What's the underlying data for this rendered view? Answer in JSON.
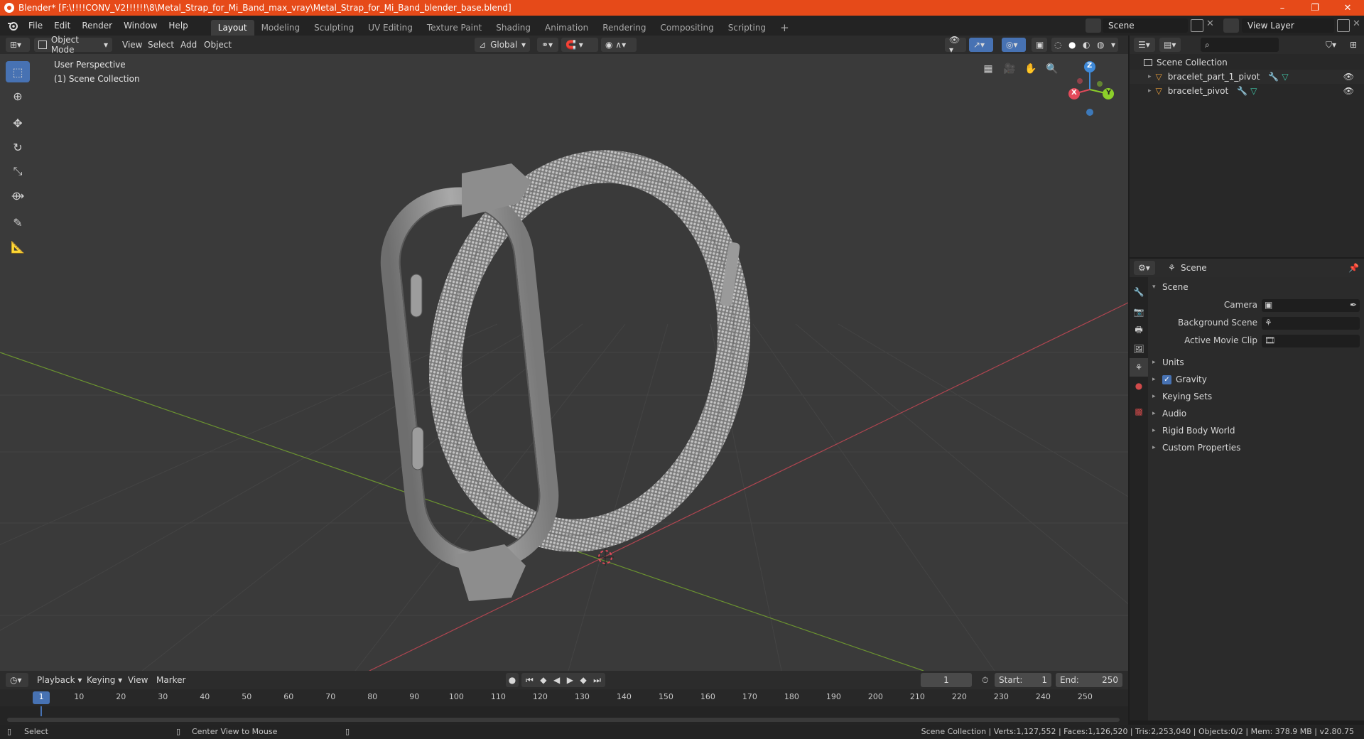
{
  "window": {
    "title": "Blender* [F:\\!!!!CONV_V2!!!!!!\\8\\Metal_Strap_for_Mi_Band_max_vray\\Metal_Strap_for_Mi_Band_blender_base.blend]",
    "minimize": "–",
    "maximize": "❐",
    "close": "✕"
  },
  "menu": {
    "items": [
      "File",
      "Edit",
      "Render",
      "Window",
      "Help"
    ],
    "workspaces": [
      "Layout",
      "Modeling",
      "Sculpting",
      "UV Editing",
      "Texture Paint",
      "Shading",
      "Animation",
      "Rendering",
      "Compositing",
      "Scripting"
    ],
    "add_tab": "+",
    "scene_field": "Scene",
    "view_layer_field": "View Layer"
  },
  "viewport_header": {
    "mode": "Object Mode",
    "menus": [
      "View",
      "Select",
      "Add",
      "Object"
    ],
    "transform_orientation": "Global"
  },
  "viewport": {
    "perspective": "User Perspective",
    "collection": "(1) Scene Collection",
    "gizmo": {
      "z": "Z",
      "y": "Y",
      "x": "X"
    }
  },
  "outliner": {
    "root": "Scene Collection",
    "items": [
      {
        "label": "bracelet_part_1_pivot"
      },
      {
        "label": "bracelet_pivot"
      }
    ]
  },
  "properties": {
    "header": "Scene",
    "section": "Scene",
    "camera_label": "Camera",
    "background_scene_label": "Background Scene",
    "active_movie_clip_label": "Active Movie Clip",
    "panels": [
      "Units",
      "Gravity",
      "Keying Sets",
      "Audio",
      "Rigid Body World",
      "Custom Properties"
    ],
    "gravity_checked": true
  },
  "timeline": {
    "menus": [
      "Playback",
      "Keying",
      "View",
      "Marker"
    ],
    "current_frame": "1",
    "start_label": "Start:",
    "start_value": "1",
    "end_label": "End:",
    "end_value": "250",
    "ticks": [
      "1",
      "10",
      "20",
      "30",
      "40",
      "50",
      "60",
      "70",
      "80",
      "90",
      "100",
      "110",
      "120",
      "130",
      "140",
      "150",
      "160",
      "170",
      "180",
      "190",
      "200",
      "210",
      "220",
      "230",
      "240",
      "250"
    ]
  },
  "statusbar": {
    "left_action": "Select",
    "middle_action": "Center View to Mouse",
    "stats": "Scene Collection | Verts:1,127,552 | Faces:1,126,520 | Tris:2,253,040 | Objects:0/2 | Mem: 378.9 MB | v2.80.75"
  },
  "colors": {
    "titlebar": "#e64a19",
    "accent": "#4772b3",
    "axis_x": "#e34a5a",
    "axis_y": "#8ccf2a",
    "axis_z": "#3f8ad9"
  }
}
